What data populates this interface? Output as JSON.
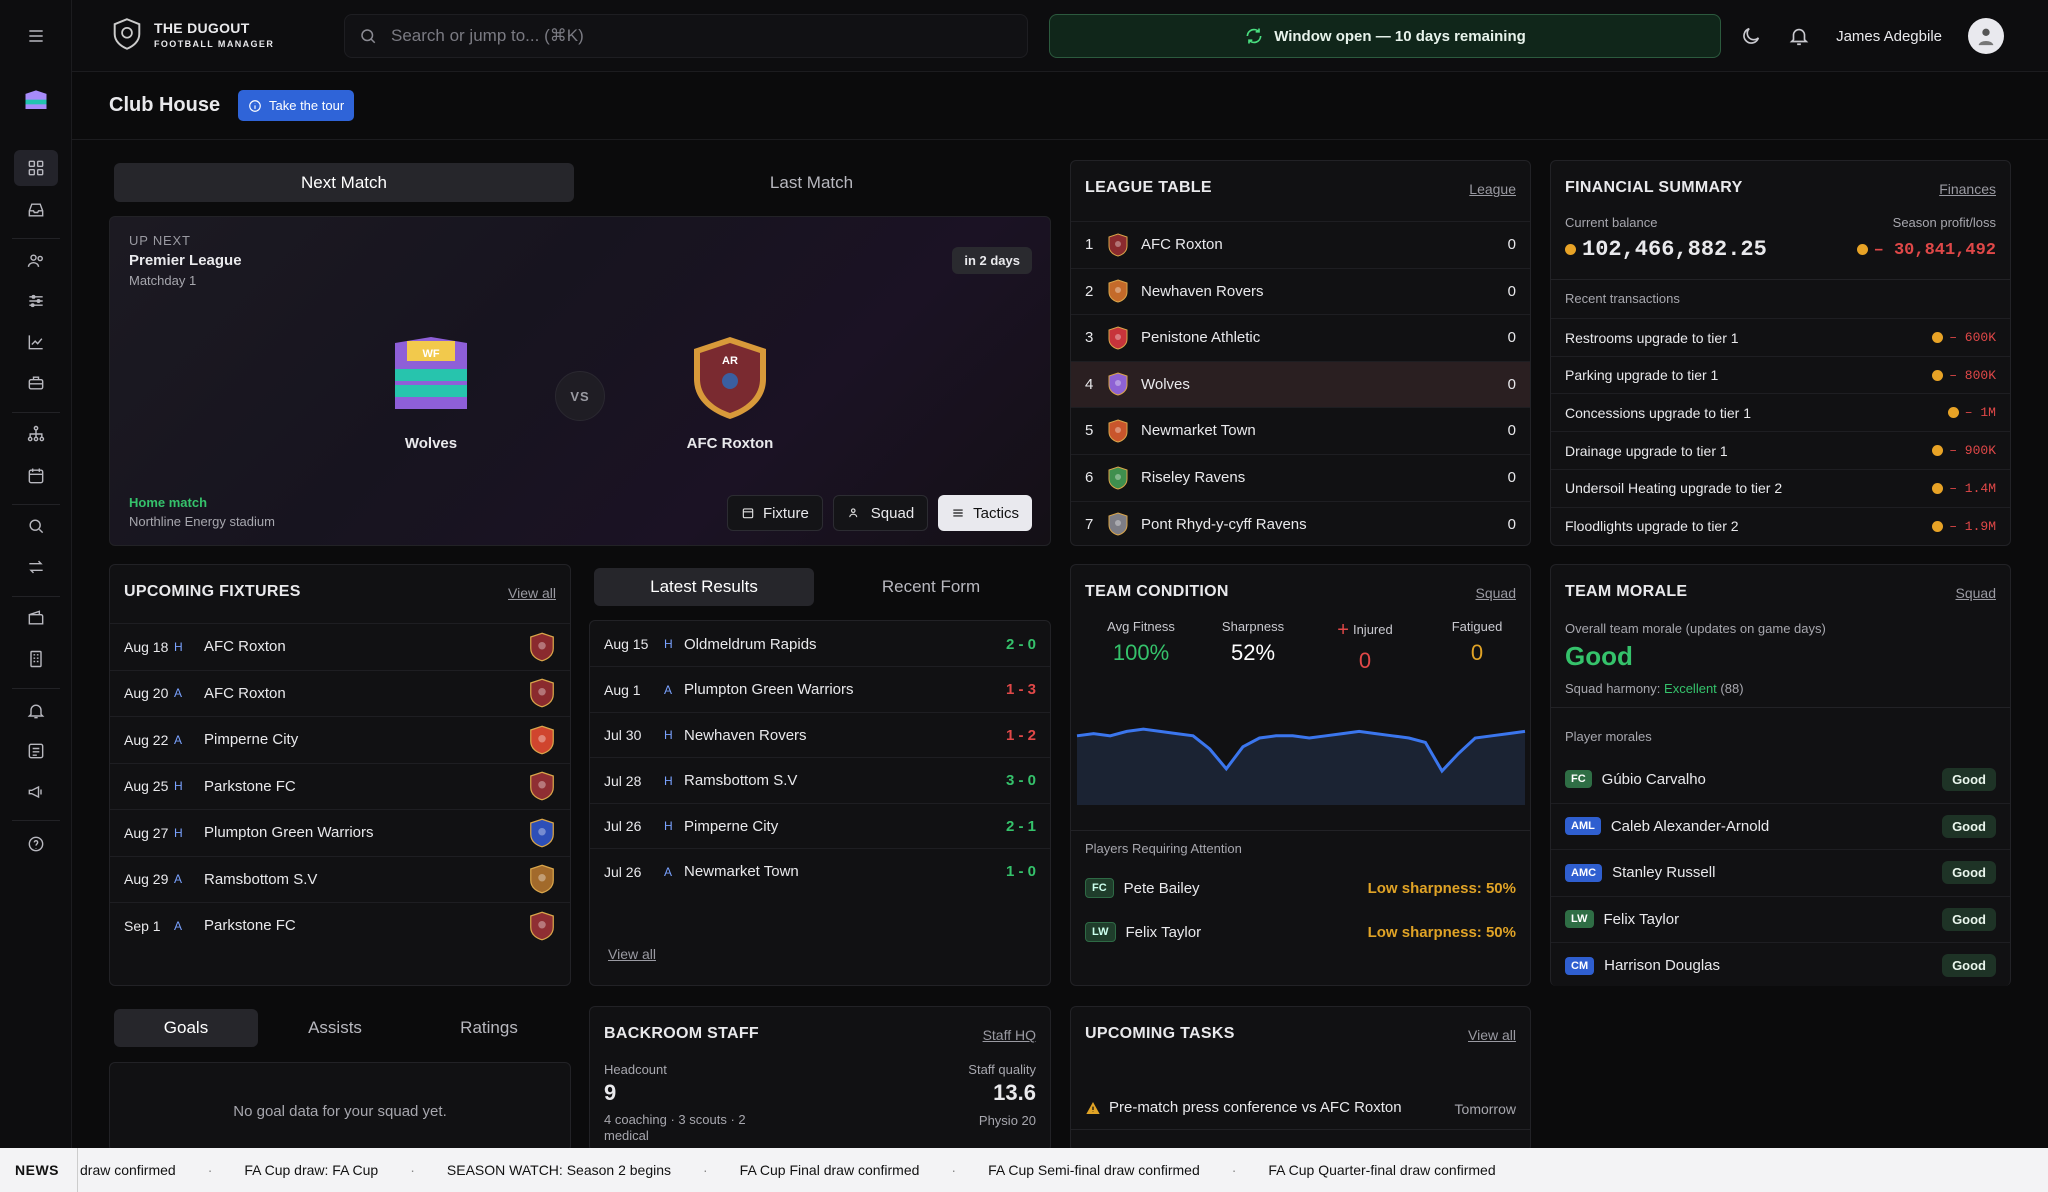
{
  "app": {
    "brand_line1": "THE DUGOUT",
    "brand_line2": "FOOTBALL MANAGER"
  },
  "search": {
    "placeholder": "Search or jump to... (⌘K)"
  },
  "window_banner": "Window open — 10 days remaining",
  "user": {
    "name": "James Adegbile"
  },
  "page": {
    "title": "Club House",
    "tour_label": "Take the tour"
  },
  "match_tabs": [
    "Next Match",
    "Last Match"
  ],
  "next_match": {
    "up_next": "UP NEXT",
    "competition": "Premier League",
    "matchday": "Matchday 1",
    "countdown": "in 2 days",
    "home_team": "Wolves",
    "home_badge": "WF",
    "away_team": "AFC Roxton",
    "away_badge": "AR",
    "vs": "VS",
    "venue_type": "Home match",
    "stadium": "Northline Energy stadium",
    "buttons": [
      "Fixture",
      "Squad",
      "Tactics"
    ]
  },
  "league_table": {
    "title": "LEAGUE TABLE",
    "link": "League",
    "rows": [
      {
        "pos": "1",
        "team": "AFC Roxton",
        "pts": "0",
        "color": "#8a2a2e"
      },
      {
        "pos": "2",
        "team": "Newhaven Rovers",
        "pts": "0",
        "color": "#c46a2a"
      },
      {
        "pos": "3",
        "team": "Penistone Athletic",
        "pts": "0",
        "color": "#c7343b"
      },
      {
        "pos": "4",
        "team": "Wolves",
        "pts": "0",
        "color": "#8d62d4"
      },
      {
        "pos": "5",
        "team": "Newmarket Town",
        "pts": "0",
        "color": "#c9552c"
      },
      {
        "pos": "6",
        "team": "Riseley Ravens",
        "pts": "0",
        "color": "#3f8f4e"
      },
      {
        "pos": "7",
        "team": "Pont Rhyd-y-cyff Ravens",
        "pts": "0",
        "color": "#7d7d85"
      }
    ]
  },
  "financial": {
    "title": "FINANCIAL SUMMARY",
    "link": "Finances",
    "balance_label": "Current balance",
    "balance": "102,466,882.25",
    "profit_label": "Season profit/loss",
    "profit": "– 30,841,492",
    "recent_label": "Recent transactions",
    "transactions": [
      {
        "label": "Restrooms upgrade to tier 1",
        "amount": "– 600K"
      },
      {
        "label": "Parking upgrade to tier 1",
        "amount": "– 800K"
      },
      {
        "label": "Concessions upgrade to tier 1",
        "amount": "– 1M"
      },
      {
        "label": "Drainage upgrade to tier 1",
        "amount": "– 900K"
      },
      {
        "label": "Undersoil Heating upgrade to tier 2",
        "amount": "– 1.4M"
      },
      {
        "label": "Floodlights upgrade to tier 2",
        "amount": "– 1.9M"
      }
    ]
  },
  "upcoming_fixtures": {
    "title": "UPCOMING FIXTURES",
    "link": "View all",
    "rows": [
      {
        "date": "Aug 18",
        "ha": "H",
        "team": "AFC Roxton",
        "color": "#8a2a2e"
      },
      {
        "date": "Aug 20",
        "ha": "A",
        "team": "AFC Roxton",
        "color": "#8a2a2e"
      },
      {
        "date": "Aug 22",
        "ha": "A",
        "team": "Pimperne City",
        "color": "#d0452e"
      },
      {
        "date": "Aug 25",
        "ha": "H",
        "team": "Parkstone FC",
        "color": "#8f2e33"
      },
      {
        "date": "Aug 27",
        "ha": "H",
        "team": "Plumpton Green Warriors",
        "color": "#2d4fb8"
      },
      {
        "date": "Aug 29",
        "ha": "A",
        "team": "Ramsbottom S.V",
        "color": "#a26a2b"
      },
      {
        "date": "Sep 1",
        "ha": "A",
        "team": "Parkstone FC",
        "color": "#8f2e33"
      }
    ]
  },
  "results_tabs": [
    "Latest Results",
    "Recent Form"
  ],
  "latest_results": {
    "link": "View all",
    "rows": [
      {
        "date": "Aug 15",
        "ha": "H",
        "team": "Oldmeldrum Rapids",
        "score": "2 - 0",
        "outcome": "win"
      },
      {
        "date": "Aug 1",
        "ha": "A",
        "team": "Plumpton Green Warriors",
        "score": "1 - 3",
        "outcome": "loss"
      },
      {
        "date": "Jul 30",
        "ha": "H",
        "team": "Newhaven Rovers",
        "score": "1 - 2",
        "outcome": "loss"
      },
      {
        "date": "Jul 28",
        "ha": "H",
        "team": "Ramsbottom S.V",
        "score": "3 - 0",
        "outcome": "win"
      },
      {
        "date": "Jul 26",
        "ha": "H",
        "team": "Pimperne City",
        "score": "2 - 1",
        "outcome": "win"
      },
      {
        "date": "Jul 26",
        "ha": "A",
        "team": "Newmarket Town",
        "score": "1 - 0",
        "outcome": "win"
      }
    ]
  },
  "team_condition": {
    "title": "TEAM CONDITION",
    "link": "Squad",
    "stats": [
      {
        "label": "Avg Fitness",
        "value": "100%"
      },
      {
        "label": "Sharpness",
        "value": "52%"
      },
      {
        "label": "Injured",
        "value": "0"
      },
      {
        "label": "Fatigued",
        "value": "0"
      }
    ],
    "fitness_trend": [
      72,
      74,
      72,
      76,
      78,
      76,
      74,
      72,
      60,
      42,
      62,
      70,
      72,
      72,
      70,
      72,
      74,
      76,
      74,
      72,
      70,
      66,
      40,
      56,
      70,
      72,
      74,
      76
    ],
    "attention_label": "Players Requiring Attention",
    "attention": [
      {
        "pos": "FC",
        "name": "Pete Bailey",
        "issue": "Low sharpness: 50%"
      },
      {
        "pos": "LW",
        "name": "Felix Taylor",
        "issue": "Low sharpness: 50%"
      }
    ]
  },
  "team_morale": {
    "title": "TEAM MORALE",
    "link": "Squad",
    "overall_label": "Overall team morale (updates on game days)",
    "overall": "Good",
    "harmony_label": "Squad harmony:",
    "harmony_value": "Excellent",
    "harmony_score": "(88)",
    "players_label": "Player morales",
    "players": [
      {
        "pos": "FC",
        "name": "Gúbio Carvalho",
        "morale": "Good",
        "color": "#2f6e45"
      },
      {
        "pos": "AML",
        "name": "Caleb Alexander-Arnold",
        "morale": "Good",
        "color": "#2f5fd0"
      },
      {
        "pos": "AMC",
        "name": "Stanley Russell",
        "morale": "Good",
        "color": "#2f5fd0"
      },
      {
        "pos": "LW",
        "name": "Felix Taylor",
        "morale": "Good",
        "color": "#2f6e45"
      },
      {
        "pos": "CM",
        "name": "Harrison Douglas",
        "morale": "Good",
        "color": "#2f5fd0"
      }
    ]
  },
  "stats_tabs": [
    "Goals",
    "Assists",
    "Ratings"
  ],
  "goals_empty": "No goal data for your squad yet.",
  "backroom": {
    "title": "BACKROOM STAFF",
    "link": "Staff HQ",
    "headcount_label": "Headcount",
    "headcount": "9",
    "breakdown": "4 coaching · 3 scouts · 2 medical",
    "quality_label": "Staff quality",
    "quality": "13.6",
    "physio": "Physio 20"
  },
  "tasks": {
    "title": "UPCOMING TASKS",
    "link": "View all",
    "items": [
      {
        "label": "Pre-match press conference vs AFC Roxton",
        "when": "Tomorrow"
      }
    ]
  },
  "news": {
    "label": "NEWS",
    "items": [
      "draw confirmed",
      "FA Cup draw: FA Cup",
      "SEASON WATCH: Season 2 begins",
      "FA Cup Final draw confirmed",
      "FA Cup Semi-final draw confirmed",
      "FA Cup Quarter-final draw confirmed"
    ]
  },
  "colors": {
    "accent": "#2f64d8",
    "positive": "#35c26b",
    "negative": "#e04848",
    "warning": "#e0a326"
  }
}
